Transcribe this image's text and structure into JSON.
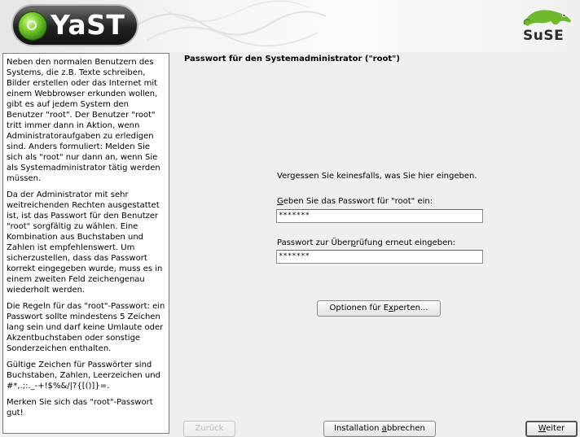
{
  "header": {
    "app_name": "YaST",
    "vendor_logo": "SuSE"
  },
  "help": {
    "paragraphs": [
      "Neben den normalen Benutzern des Systems, die z.B. Texte schreiben, Bilder erstellen oder das Internet mit einem Webbrowser erkunden wollen, gibt es auf jedem System den Benutzer \"root\". Der Benutzer \"root\" tritt immer dann in Aktion, wenn Administratoraufgaben zu erledigen sind. Anders formuliert: Melden Sie sich als \"root\" nur dann an, wenn Sie als Systemadministrator tätig werden müssen.",
      "Da der Administrator mit sehr weitreichenden Rechten ausgestattet ist, ist das Passwort für den Benutzer \"root\" sorgfältig zu wählen. Eine Kombination aus Buchstaben und Zahlen ist empfehlenswert. Um sicherzustellen, dass das Passwort korrekt eingegeben wurde, muss es in einem zweiten Feld zeichengenau wiederholt werden.",
      "Die Regeln für das \"root\"-Passwort: ein Passwort sollte mindestens 5 Zeichen lang sein und darf keine Umlaute oder Akzentbuchstaben oder sonstige Sonderzeichen enthalten.",
      "Gültige Zeichen für Passwörter sind Buchstaben, Zahlen, Leerzeichen und #*,.;:._-+!$%&/|?{[()]}=.",
      "Merken Sie sich das \"root\"-Passwort gut!"
    ]
  },
  "dialog": {
    "title": "Passwort für den Systemadministrator (\"root\")",
    "warning": "Vergessen Sie keinesfalls, was Sie hier eingeben.",
    "password_label": {
      "mnemonic": "G",
      "rest": "eben Sie das Passwort für \"root\" ein:"
    },
    "password_value": "*******",
    "confirm_label": {
      "before": "Passwort zur Über",
      "mnemonic": "p",
      "after": "rüfung erneut eingeben:"
    },
    "confirm_value": "*******",
    "expert_button": {
      "before": "Optionen für E",
      "mnemonic": "x",
      "after": "perten..."
    }
  },
  "footer": {
    "back_button": "Zurück",
    "abort_button": {
      "before": "Installation ",
      "mnemonic": "a",
      "after": "bbrechen"
    },
    "next_button": {
      "mnemonic": "W",
      "after": "eiter"
    }
  }
}
